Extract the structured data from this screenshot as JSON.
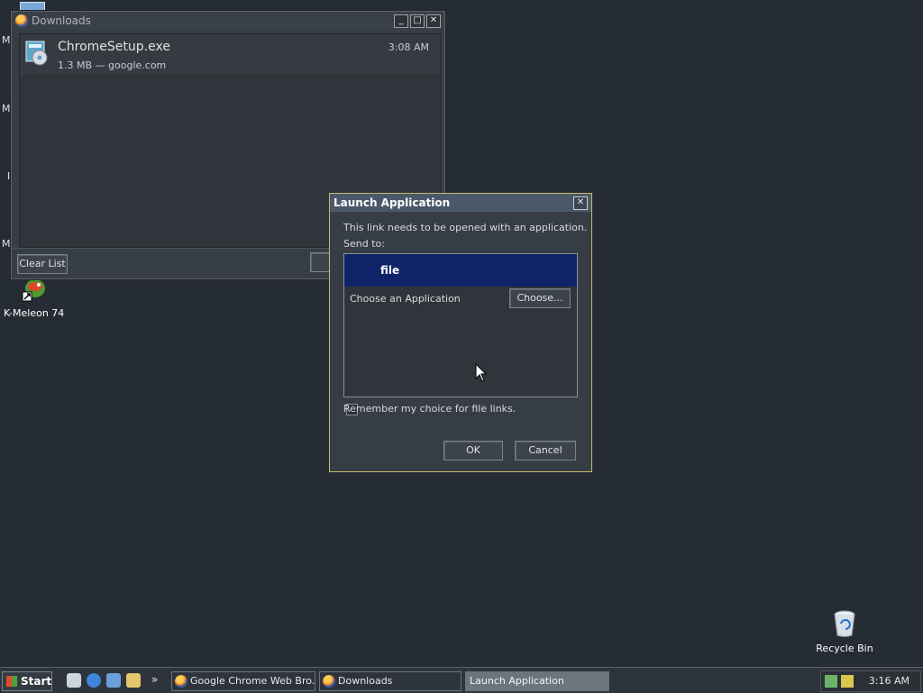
{
  "desktop": {
    "icons": [
      {
        "label": "K-Meleon 74"
      },
      {
        "label": "Recycle Bin"
      }
    ],
    "edge_letters": [
      "M",
      "M",
      "I",
      "M"
    ]
  },
  "downloads": {
    "title": "Downloads",
    "items": [
      {
        "name": "ChromeSetup.exe",
        "meta": "1.3 MB — google.com",
        "time": "3:08 AM"
      }
    ],
    "clear_list_label": "Clear List"
  },
  "launch_dialog": {
    "title": "Launch Application",
    "message": "This link needs to be opened with an application.",
    "send_to_label": "Send to:",
    "file_row": "file",
    "choose_app_label": "Choose an Application",
    "choose_button": "Choose...",
    "remember_label": "Remember my choice for file links.",
    "remember_checked": false,
    "ok_label": "OK",
    "cancel_label": "Cancel"
  },
  "taskbar": {
    "start_label": "Start",
    "overflow": "»",
    "tasks": [
      {
        "label": "Google Chrome Web Bro...",
        "active": false
      },
      {
        "label": "Downloads",
        "active": false
      },
      {
        "label": "Launch Application",
        "active": true
      }
    ],
    "clock": "3:16 AM"
  },
  "colors": {
    "desktop_bg": "#262c33",
    "selection_blue": "#0f2468",
    "dialog_border": "#c8b96b"
  }
}
